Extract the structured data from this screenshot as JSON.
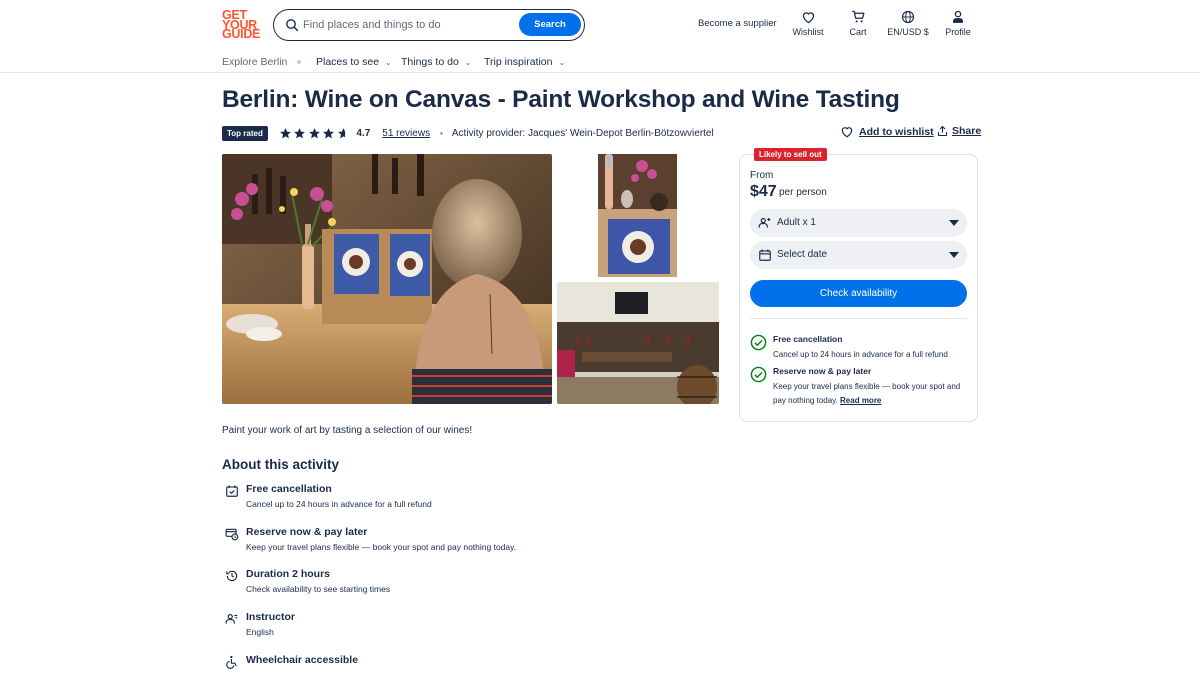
{
  "header": {
    "logo_lines": [
      "GET",
      "YOUR",
      "GUIDE"
    ],
    "search_placeholder": "Find places and things to do",
    "search_button": "Search",
    "supplier_link": "Become a supplier",
    "icons": [
      {
        "label": "Wishlist",
        "icon": "heart-icon"
      },
      {
        "label": "Cart",
        "icon": "cart-icon"
      },
      {
        "label": "EN/USD $",
        "icon": "globe-icon"
      },
      {
        "label": "Profile",
        "icon": "user-icon"
      }
    ]
  },
  "nav": {
    "explore": "Explore Berlin",
    "items": [
      "Places to see",
      "Things to do",
      "Trip inspiration"
    ]
  },
  "activity": {
    "title": "Berlin: Wine on Canvas - Paint Workshop and Wine Tasting",
    "badge": "Top rated",
    "rating": "4.7",
    "rating_value": 4.7,
    "reviews": "51 reviews",
    "provider": "Activity provider: Jacques' Wein-Depot Berlin-Bötzowviertel",
    "add_to_wishlist": "Add to wishlist",
    "share": "Share",
    "tagline": "Paint your work of art by tasting a selection of our wines!"
  },
  "about": {
    "heading": "About this activity",
    "features": [
      {
        "icon": "calendar-check-icon",
        "title": "Free cancellation",
        "desc": "Cancel up to 24 hours in advance for a full refund"
      },
      {
        "icon": "card-clock-icon",
        "title": "Reserve now & pay later",
        "desc": "Keep your travel plans flexible — book your spot and pay nothing today."
      },
      {
        "icon": "clock-icon",
        "title": "Duration 2 hours",
        "desc": "Check availability to see starting times"
      },
      {
        "icon": "instructor-icon",
        "title": "Instructor",
        "desc": "English"
      },
      {
        "icon": "wheelchair-icon",
        "title": "Wheelchair accessible",
        "desc": ""
      }
    ]
  },
  "booking": {
    "badge": "Likely to sell out",
    "from": "From",
    "price": "$47",
    "per": "per person",
    "participants": "Adult x 1",
    "date": "Select date",
    "cta": "Check availability",
    "perks": [
      {
        "title": "Free cancellation",
        "desc": "Cancel up to 24 hours in advance for a full refund"
      },
      {
        "title": "Reserve now & pay later",
        "desc": "Keep your travel plans flexible — book your spot and pay nothing today.",
        "link": "Read more"
      }
    ]
  },
  "colors": {
    "navy": "#1a2b49",
    "brand": "#ff5533",
    "primary": "#0071eb",
    "sell_out": "#d9242c",
    "success": "#008009"
  }
}
